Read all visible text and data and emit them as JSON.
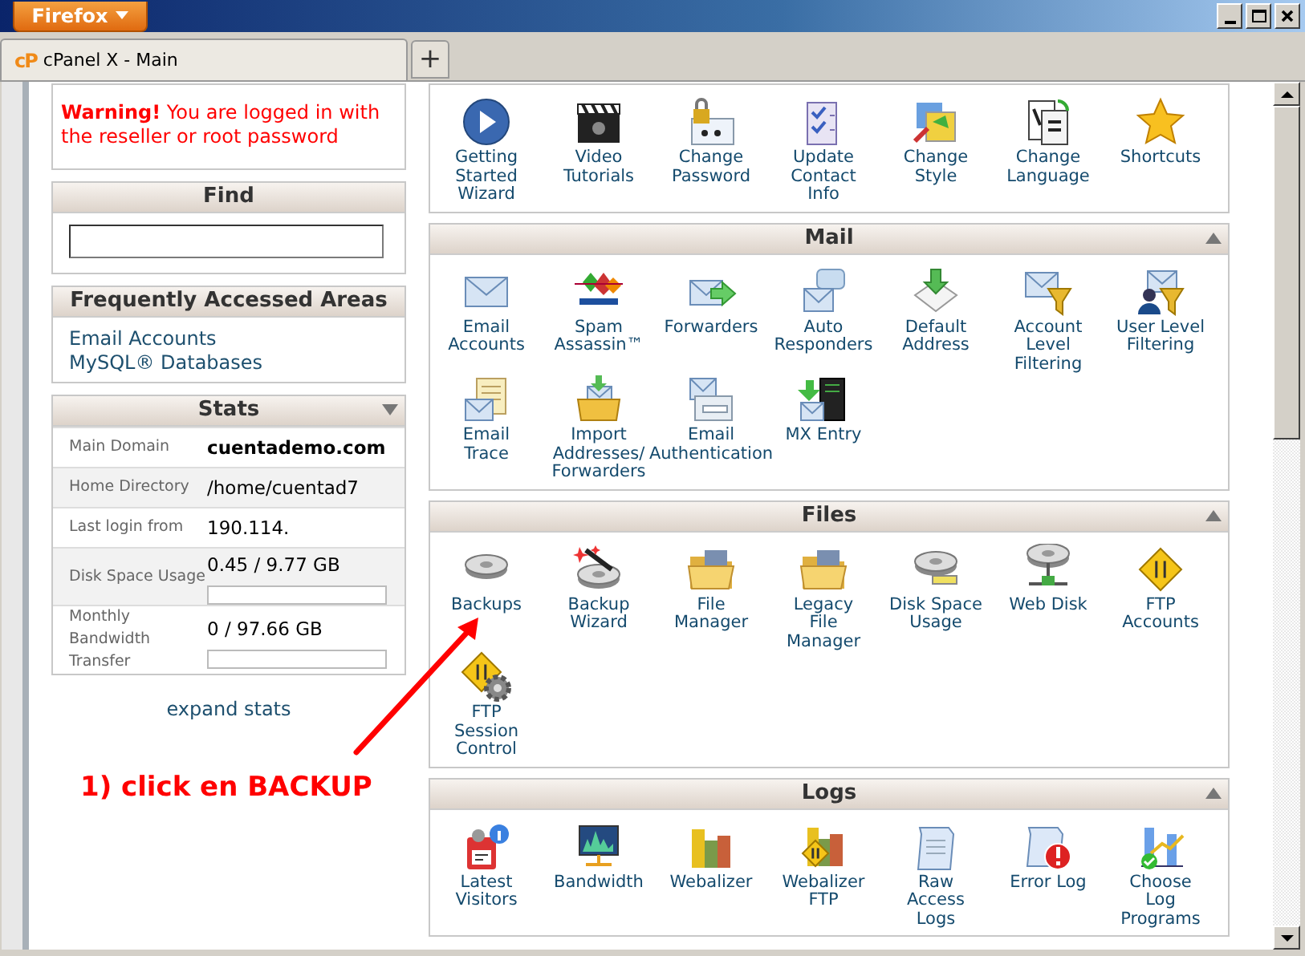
{
  "browser": {
    "menu_button": "Firefox",
    "tab": {
      "favicon": "cP",
      "title": "cPanel X - Main",
      "selected": true
    },
    "new_tab": "+"
  },
  "sidebar": {
    "warning": "**Warning!** You are logged in with the reseller or root password",
    "find": {
      "title": "Find"
    },
    "frequently_accessed": {
      "title": "Frequently Accessed Areas",
      "links": [
        "Email Accounts",
        "MySQL® Databases"
      ]
    },
    "stats": {
      "title": "Stats",
      "rows": [
        {
          "label": "Main Domain",
          "value": "cuentademo.com"
        },
        {
          "label": "Home Directory",
          "value": "/home/cuentad7"
        },
        {
          "label": "Last login from",
          "value": "190.114."
        },
        {
          "label": "Disk Space Usage",
          "value": "0.45 / 9.77 GB",
          "level": 0
        },
        {
          "label": "Monthly Bandwidth Transfer",
          "value": "0 / 97.66 GB",
          "level": 0
        }
      ],
      "expand_link": "expand stats"
    }
  },
  "sections": [
    {
      "items": [
        "Getting Started Wizard",
        "Video Tutorials",
        "Change Password",
        "Update Contact Info",
        "Change Style",
        "Change Language",
        "Shortcuts"
      ]
    },
    {
      "title": "Mail",
      "items": [
        "Email Accounts",
        "Spam Assassin™",
        "Forwarders",
        "Auto Responders",
        "Default Address",
        "Account Level Filtering",
        "User Level Filtering",
        "Email Trace",
        "Import Addresses/ Forwarders",
        "Email Authentication",
        "MX Entry"
      ]
    },
    {
      "title": "Files",
      "items": [
        "Backups",
        "Backup Wizard",
        "File Manager",
        "Legacy File Manager",
        "Disk Space Usage",
        "Web Disk",
        "FTP Accounts",
        "FTP Session Control"
      ]
    },
    {
      "title": "Logs",
      "items": [
        "Latest Visitors",
        "Bandwidth",
        "Webalizer",
        "Webalizer FTP",
        "Raw Access Logs",
        "Error Log",
        "Choose Log Programs"
      ]
    }
  ],
  "annotation": {
    "text": "1) click en BACKUP"
  }
}
